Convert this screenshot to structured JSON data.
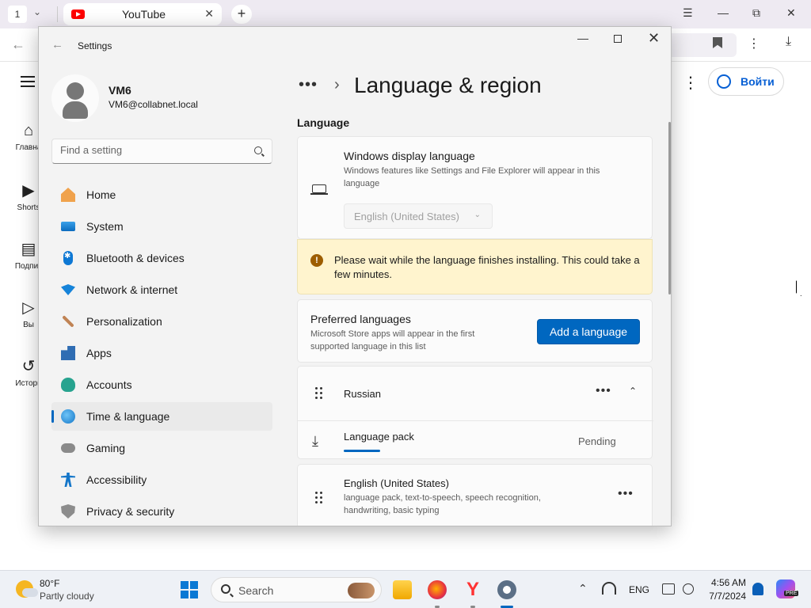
{
  "browser": {
    "tab_counter": "1",
    "tab_title": "YouTube",
    "youtube": {
      "sidebar": [
        {
          "label": "Главна",
          "icon": "home-icon"
        },
        {
          "label": "Shorts",
          "icon": "shorts-icon"
        },
        {
          "label": "Подпис",
          "icon": "subscriptions-icon"
        },
        {
          "label": "Вы",
          "icon": "you-icon"
        },
        {
          "label": "Истори",
          "icon": "history-icon"
        }
      ],
      "login_label": "Войти"
    }
  },
  "settings": {
    "window_title": "Settings",
    "user": {
      "name": "VM6",
      "email": "VM6@collabnet.local"
    },
    "search_placeholder": "Find a setting",
    "nav": [
      {
        "label": "Home",
        "icon": "home-icon"
      },
      {
        "label": "System",
        "icon": "system-icon"
      },
      {
        "label": "Bluetooth & devices",
        "icon": "bluetooth-icon"
      },
      {
        "label": "Network & internet",
        "icon": "wifi-icon"
      },
      {
        "label": "Personalization",
        "icon": "brush-icon"
      },
      {
        "label": "Apps",
        "icon": "apps-icon"
      },
      {
        "label": "Accounts",
        "icon": "accounts-icon"
      },
      {
        "label": "Time & language",
        "icon": "time-language-icon",
        "active": true
      },
      {
        "label": "Gaming",
        "icon": "gaming-icon"
      },
      {
        "label": "Accessibility",
        "icon": "accessibility-icon"
      },
      {
        "label": "Privacy & security",
        "icon": "shield-icon"
      }
    ],
    "breadcrumb_dots": "•••",
    "page_title": "Language & region",
    "section_language": "Language",
    "display_language": {
      "title": "Windows display language",
      "description": "Windows features like Settings and File Explorer will appear in this language",
      "selected": "English (United States)"
    },
    "warning": "Please wait while the language finishes installing. This could take a few minutes.",
    "preferred": {
      "title": "Preferred languages",
      "description": "Microsoft Store apps will appear in the first supported language in this list",
      "add_button": "Add a language"
    },
    "languages": [
      {
        "name": "Russian",
        "pack_label": "Language pack",
        "pack_status": "Pending",
        "pack_progress": 0.12
      },
      {
        "name": "English (United States)",
        "description": "language pack, text-to-speech, speech recognition, handwriting, basic typing"
      }
    ]
  },
  "taskbar": {
    "weather_temp": "80°F",
    "weather_desc": "Partly cloudy",
    "search_label": "Search",
    "lang": "ENG",
    "time": "4:56 AM",
    "date": "7/7/2024",
    "copilot_badge": "PRE"
  }
}
